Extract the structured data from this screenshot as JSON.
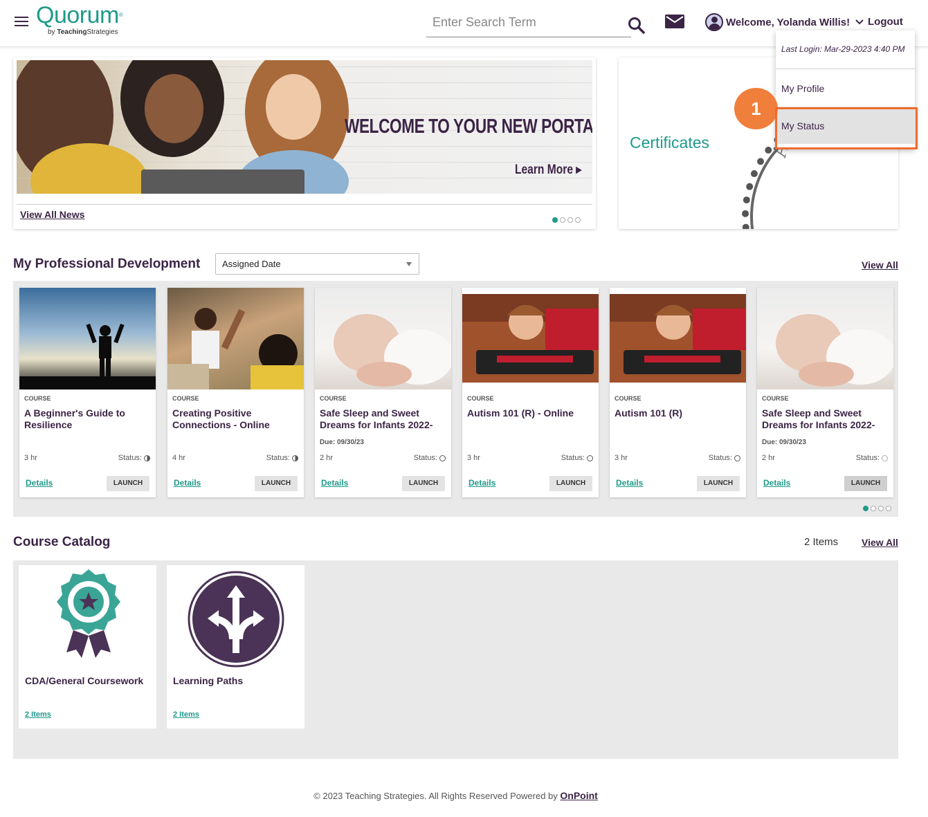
{
  "header": {
    "logo_main": "Quorum",
    "logo_by": "by",
    "logo_brand": "Teaching",
    "logo_brand2": "Strategies",
    "search_placeholder": "Enter Search Term",
    "welcome": "Welcome, Yolanda Willis!",
    "logout": "Logout"
  },
  "dropdown": {
    "last_login": "Last Login: Mar-29-2023 4:40 PM",
    "items": [
      {
        "label": "My Profile"
      },
      {
        "label": "My Status"
      }
    ]
  },
  "step_badge": "1",
  "news": {
    "banner_title": "WELCOME TO YOUR NEW PORTAL",
    "banner_link": "Learn More",
    "view_all": "View All News"
  },
  "certificates": {
    "title": "Certificates",
    "seal_text": "Achieve"
  },
  "professional_development": {
    "title": "My Professional Development",
    "sort_selected": "Assigned Date",
    "view_all": "View All",
    "cards": [
      {
        "type": "COURSE",
        "title": "A Beginner's Guide to Resilience",
        "due": "",
        "hours": "3 hr",
        "status_label": "Status:",
        "details": "Details",
        "launch": "LAUNCH"
      },
      {
        "type": "COURSE",
        "title": "Creating Positive Connections - Online",
        "due": "",
        "hours": "4 hr",
        "status_label": "Status:",
        "details": "Details",
        "launch": "LAUNCH"
      },
      {
        "type": "COURSE",
        "title": "Safe Sleep and Sweet Dreams for Infants 2022-",
        "due": "Due: 09/30/23",
        "hours": "2 hr",
        "status_label": "Status:",
        "details": "Details",
        "launch": "LAUNCH"
      },
      {
        "type": "COURSE",
        "title": "Autism 101 (R) - Online",
        "due": "",
        "hours": "3 hr",
        "status_label": "Status:",
        "details": "Details",
        "launch": "LAUNCH"
      },
      {
        "type": "COURSE",
        "title": "Autism 101 (R)",
        "due": "",
        "hours": "3 hr",
        "status_label": "Status:",
        "details": "Details",
        "launch": "LAUNCH"
      },
      {
        "type": "COURSE",
        "title": "Safe Sleep and Sweet Dreams for Infants 2022-",
        "due": "Due: 09/30/23",
        "hours": "2 hr",
        "status_label": "Status:",
        "details": "Details",
        "launch": "LAUNCH"
      }
    ]
  },
  "catalog": {
    "title": "Course Catalog",
    "count": "2 Items",
    "view_all": "View All",
    "items": [
      {
        "title": "CDA/General Coursework",
        "items": "2 Items"
      },
      {
        "title": "Learning Paths",
        "items": "2 Items"
      }
    ]
  },
  "footer": {
    "text": "© 2023 Teaching Strategies. All Rights Reserved Powered by",
    "link": "OnPoint"
  },
  "colors": {
    "brand_teal": "#1f9a8b",
    "brand_purple": "#3b2446",
    "highlight_orange": "#f06b2e"
  }
}
